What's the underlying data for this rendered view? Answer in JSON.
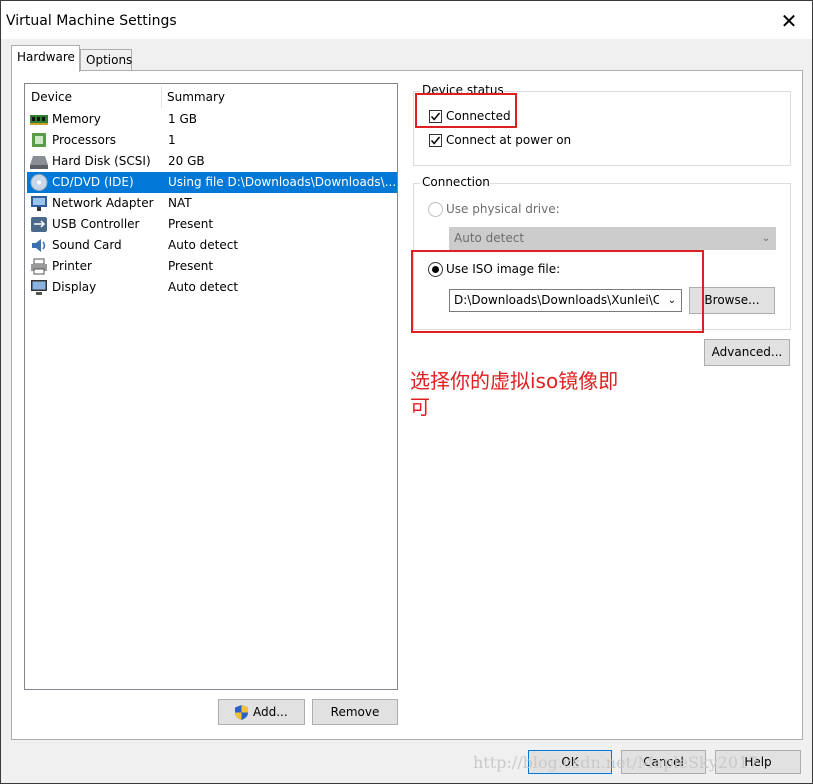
{
  "window": {
    "title": "Virtual Machine Settings",
    "close_glyph": "✕"
  },
  "tabs": [
    {
      "label": "Hardware",
      "active": true
    },
    {
      "label": "Options",
      "active": false
    }
  ],
  "device_list": {
    "headers": {
      "device": "Device",
      "summary": "Summary"
    },
    "rows": [
      {
        "device": "Memory",
        "summary": "1 GB",
        "icon": "memory-icon"
      },
      {
        "device": "Processors",
        "summary": "1",
        "icon": "processor-icon"
      },
      {
        "device": "Hard Disk (SCSI)",
        "summary": "20 GB",
        "icon": "hard-disk-icon"
      },
      {
        "device": "CD/DVD (IDE)",
        "summary": "Using file D:\\Downloads\\Downloads\\...",
        "icon": "cd-dvd-icon",
        "selected": true
      },
      {
        "device": "Network Adapter",
        "summary": "NAT",
        "icon": "network-adapter-icon"
      },
      {
        "device": "USB Controller",
        "summary": "Present",
        "icon": "usb-icon"
      },
      {
        "device": "Sound Card",
        "summary": "Auto detect",
        "icon": "sound-card-icon"
      },
      {
        "device": "Printer",
        "summary": "Present",
        "icon": "printer-icon"
      },
      {
        "device": "Display",
        "summary": "Auto detect",
        "icon": "display-icon"
      }
    ]
  },
  "buttons": {
    "add": "Add...",
    "remove": "Remove",
    "ok": "OK",
    "cancel": "Cancel",
    "help": "Help",
    "browse": "Browse...",
    "advanced": "Advanced..."
  },
  "device_status": {
    "title": "Device status",
    "connected": {
      "label": "Connected",
      "checked": true
    },
    "connect_at_power_on": {
      "label": "Connect at power on",
      "checked": true
    }
  },
  "connection": {
    "title": "Connection",
    "use_physical_drive": {
      "label": "Use physical drive:",
      "selected": false,
      "enabled": false
    },
    "physical_drive_value": "Auto detect",
    "use_iso": {
      "label": "Use ISO image file:",
      "selected": true
    },
    "iso_path": "D:\\Downloads\\Downloads\\Xunlei\\Ce"
  },
  "annotation": {
    "line1": "选择你的虚拟iso镜像即",
    "line2": "可",
    "color": "#e02020"
  },
  "watermark": "http://blog.csdn.net/MapleSky2017",
  "colors": {
    "selection": "#0078d7",
    "annotation_red": "#e02020"
  }
}
